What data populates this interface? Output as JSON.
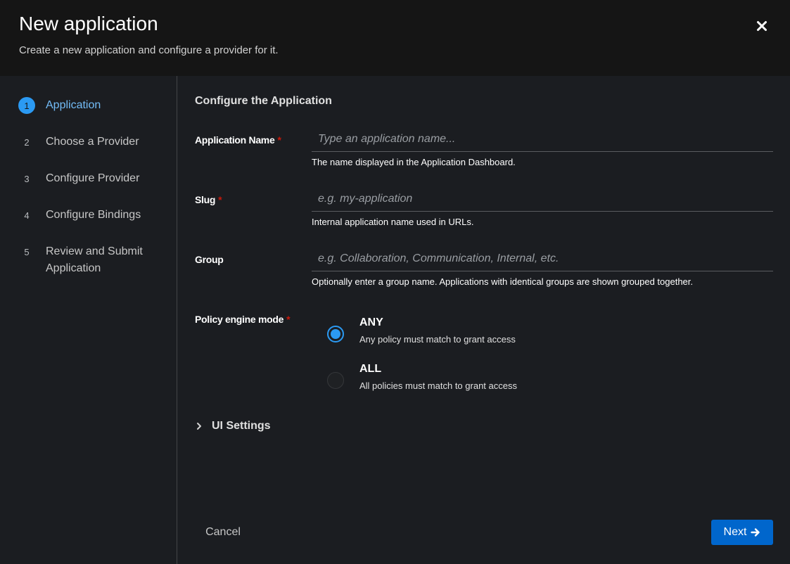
{
  "header": {
    "title": "New application",
    "subtitle": "Create a new application and configure a provider for it."
  },
  "nav": {
    "steps": [
      {
        "num": "1",
        "label": "Application",
        "current": true
      },
      {
        "num": "2",
        "label": "Choose a Provider",
        "current": false
      },
      {
        "num": "3",
        "label": "Configure Provider",
        "current": false
      },
      {
        "num": "4",
        "label": "Configure Bindings",
        "current": false
      },
      {
        "num": "5",
        "label": "Review and Submit Application",
        "current": false
      }
    ]
  },
  "form": {
    "section_title": "Configure the Application",
    "required_marker": "*",
    "app_name": {
      "label": "Application Name",
      "placeholder": "Type an application name...",
      "value": "",
      "helper": "The name displayed in the Application Dashboard."
    },
    "slug": {
      "label": "Slug",
      "placeholder": "e.g. my-application",
      "value": "",
      "helper": "Internal application name used in URLs."
    },
    "group": {
      "label": "Group",
      "placeholder": "e.g. Collaboration, Communication, Internal, etc.",
      "value": "",
      "helper": "Optionally enter a group name. Applications with identical groups are shown grouped together."
    },
    "policy_mode": {
      "label": "Policy engine mode",
      "options": [
        {
          "title": "ANY",
          "desc": "Any policy must match to grant access",
          "checked": true
        },
        {
          "title": "ALL",
          "desc": "All policies must match to grant access",
          "checked": false
        }
      ]
    },
    "ui_settings_label": "UI Settings"
  },
  "footer": {
    "cancel_label": "Cancel",
    "next_label": "Next"
  },
  "colors": {
    "accent": "#2b9af3",
    "primary_button": "#0066cc",
    "required": "#c9190b"
  },
  "icons": {
    "close": "close-icon",
    "next": "arrow-right-icon",
    "expand": "chevron-right-icon"
  }
}
